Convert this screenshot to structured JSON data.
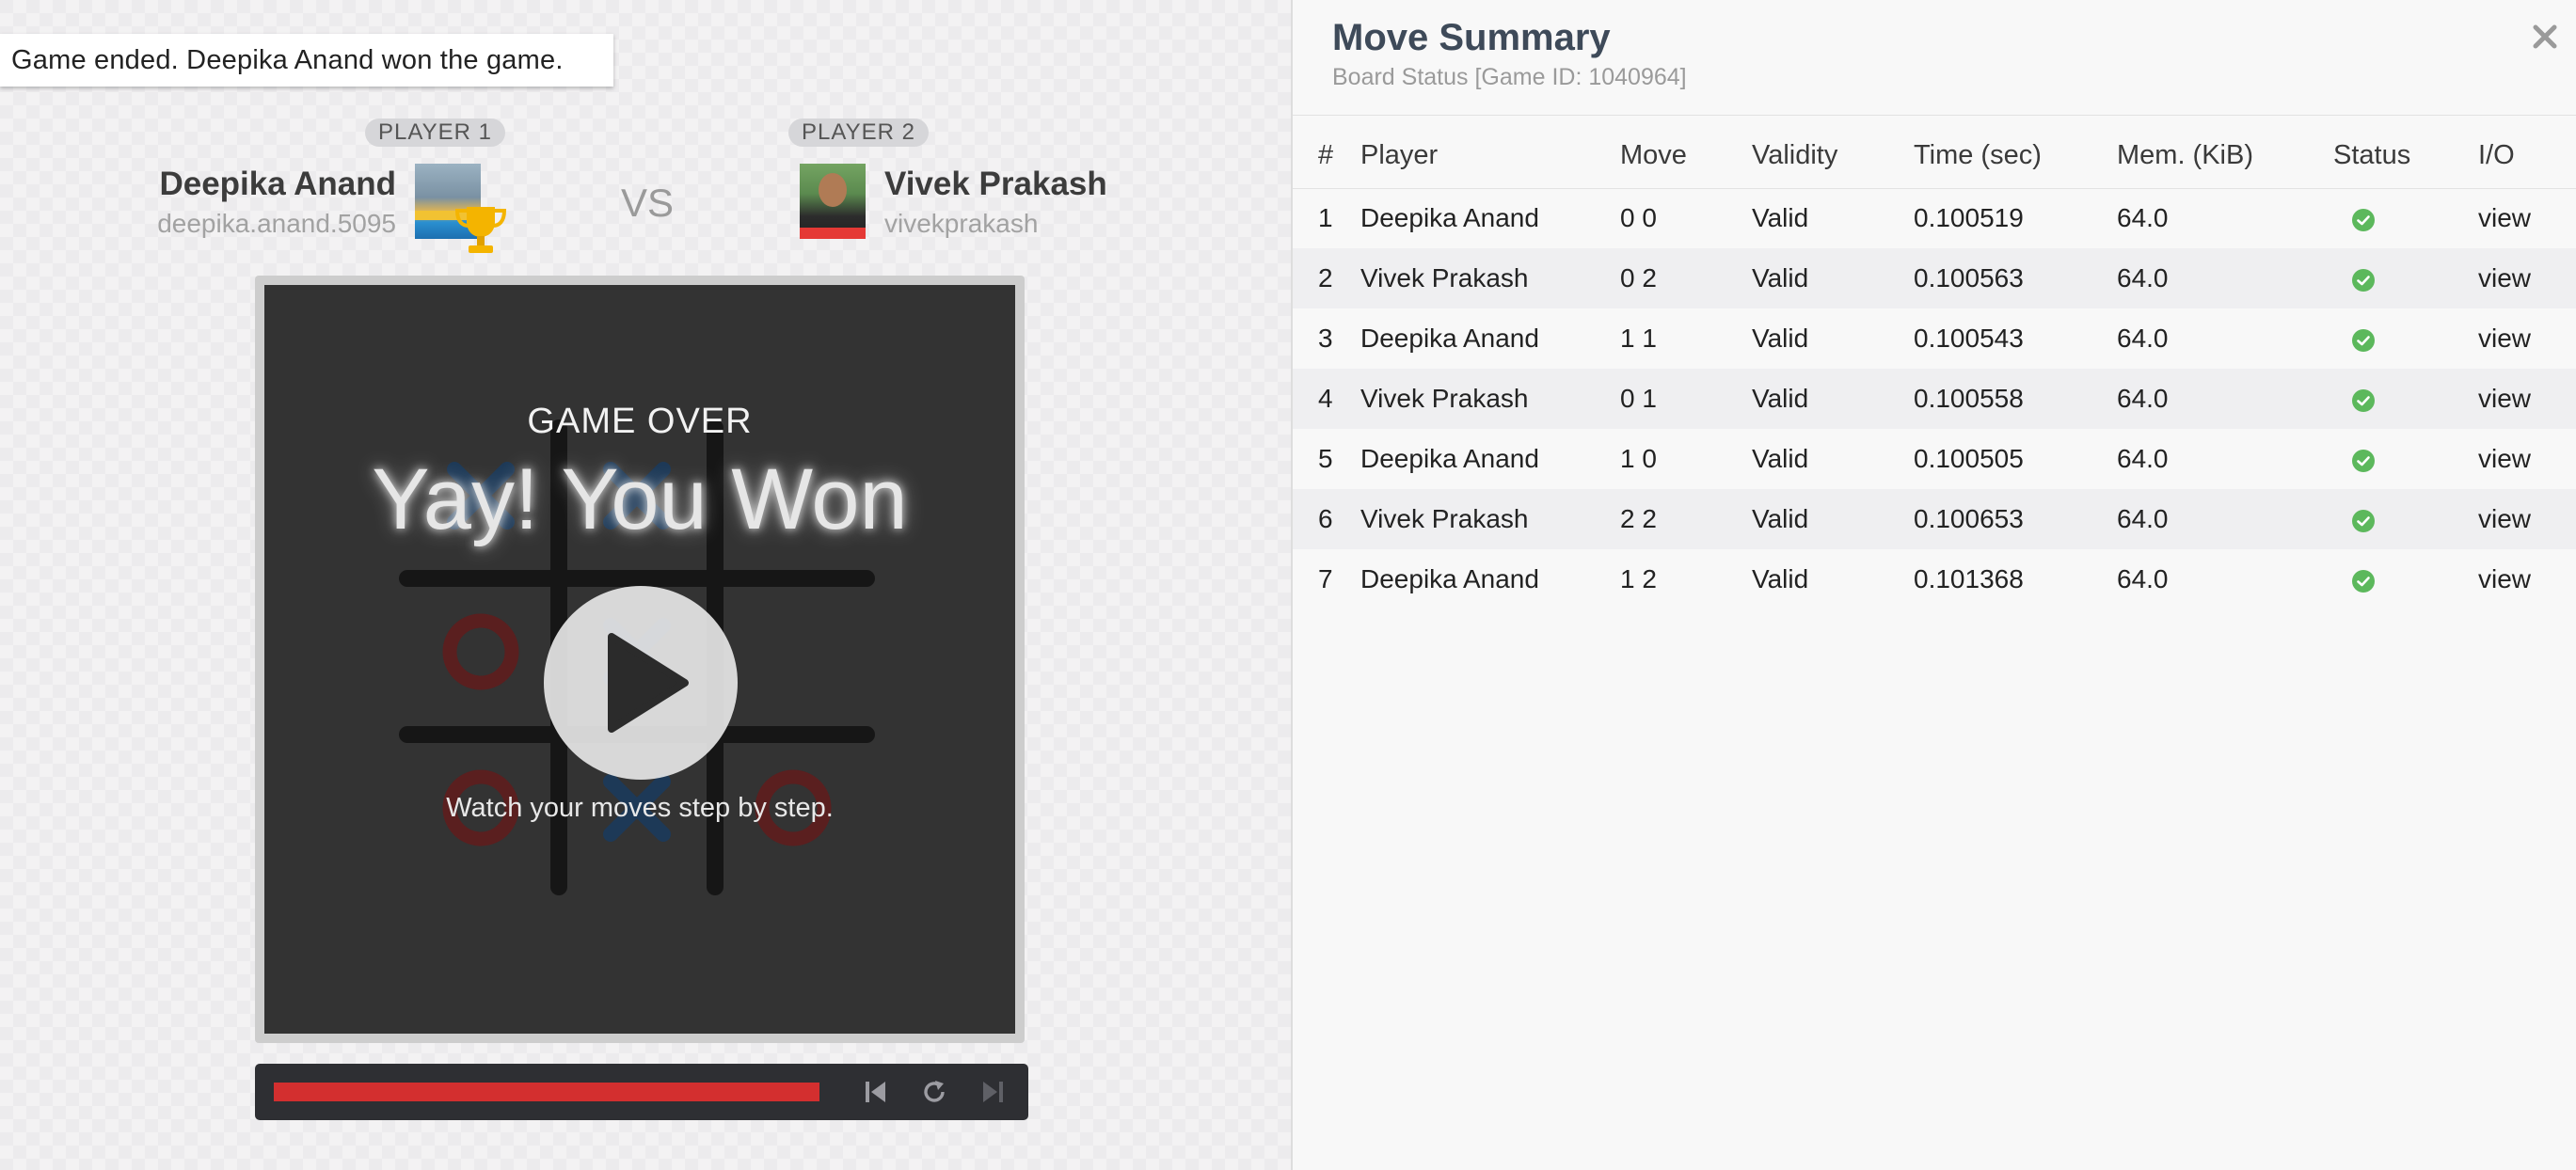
{
  "banner": {
    "text": "Game ended.  Deepika Anand won the game."
  },
  "player1": {
    "badge": "PLAYER 1",
    "name": "Deepika Anand",
    "handle": "deepika.anand.5095",
    "is_winner": true
  },
  "player2": {
    "badge": "PLAYER 2",
    "name": "Vivek Prakash",
    "handle": "vivekprakash"
  },
  "vs_label": "VS",
  "board": {
    "game_over_label": "GAME OVER",
    "win_title": "Yay! You Won",
    "caption": "Watch your moves step by step.",
    "cells": [
      [
        "X",
        "X",
        ""
      ],
      [
        "O",
        "X",
        ""
      ],
      [
        "O",
        "X",
        "O"
      ]
    ]
  },
  "playback": {
    "progress_percent": 100,
    "buttons": [
      "skip-back-icon",
      "replay-icon",
      "skip-forward-icon"
    ]
  },
  "summary": {
    "title": "Move Summary",
    "subtitle": "Board Status [Game ID: 1040964]",
    "columns": [
      "#",
      "Player",
      "Move",
      "Validity",
      "Time (sec)",
      "Mem. (KiB)",
      "Status",
      "I/O"
    ],
    "rows": [
      [
        "1",
        "Deepika Anand",
        "0 0",
        "Valid",
        "0.100519",
        "64.0",
        "ok",
        "view"
      ],
      [
        "2",
        "Vivek Prakash",
        "0 2",
        "Valid",
        "0.100563",
        "64.0",
        "ok",
        "view"
      ],
      [
        "3",
        "Deepika Anand",
        "1 1",
        "Valid",
        "0.100543",
        "64.0",
        "ok",
        "view"
      ],
      [
        "4",
        "Vivek Prakash",
        "0 1",
        "Valid",
        "0.100558",
        "64.0",
        "ok",
        "view"
      ],
      [
        "5",
        "Deepika Anand",
        "1 0",
        "Valid",
        "0.100505",
        "64.0",
        "ok",
        "view"
      ],
      [
        "6",
        "Vivek Prakash",
        "2 2",
        "Valid",
        "0.100653",
        "64.0",
        "ok",
        "view"
      ],
      [
        "7",
        "Deepika Anand",
        "1 2",
        "Valid",
        "0.101368",
        "64.0",
        "ok",
        "view"
      ]
    ]
  },
  "colors": {
    "x_mark": "#1b3a5c",
    "o_mark": "#5a1f1f",
    "progress": "#d32f2f",
    "status_ok": "#5cb85c"
  }
}
